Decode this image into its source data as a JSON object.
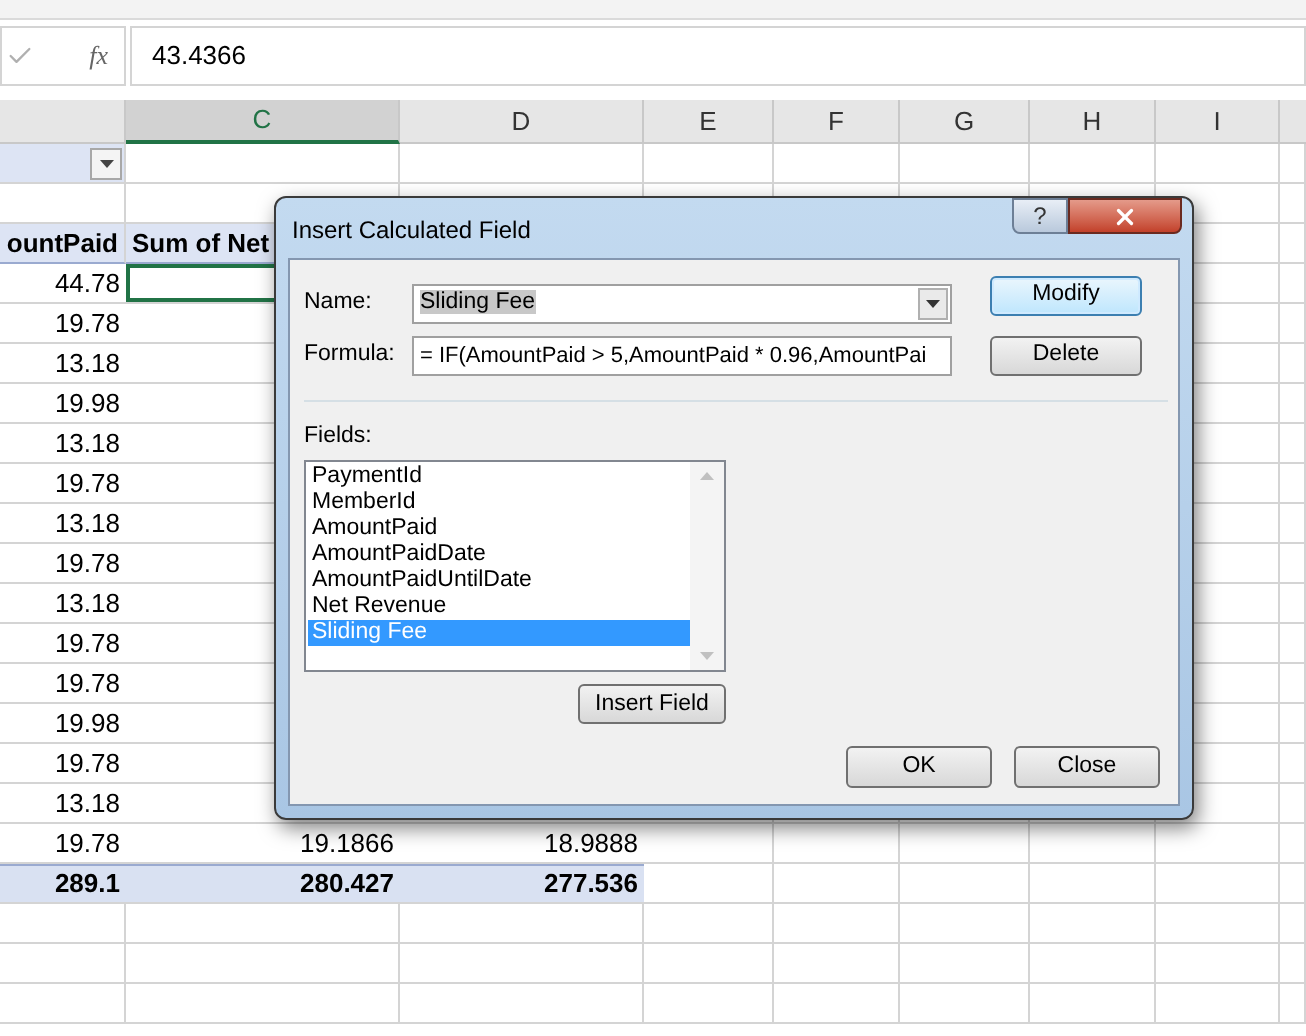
{
  "formula_bar": {
    "function_glyph": "fx",
    "value": "43.4366"
  },
  "columns": [
    {
      "selected": false
    },
    {
      "label": "C",
      "selected": true
    },
    {
      "label": "D",
      "selected": false
    },
    {
      "label": "E",
      "selected": false
    },
    {
      "label": "F",
      "selected": false
    },
    {
      "label": "G",
      "selected": false
    },
    {
      "label": "H",
      "selected": false
    },
    {
      "label": "I",
      "selected": false
    }
  ],
  "pivot": {
    "filter_dropdown": true,
    "header": [
      "ountPaid",
      "Sum of Net"
    ],
    "rows": [
      {
        "cells": [
          "44.78"
        ],
        "selected": true
      },
      {
        "cells": [
          "19.78"
        ],
        "selected": false
      },
      {
        "cells": [
          "13.18"
        ],
        "selected": false
      },
      {
        "cells": [
          "19.98"
        ],
        "selected": false
      },
      {
        "cells": [
          "13.18"
        ],
        "selected": false
      },
      {
        "cells": [
          "19.78"
        ],
        "selected": false
      },
      {
        "cells": [
          "13.18"
        ],
        "selected": false
      },
      {
        "cells": [
          "19.78"
        ],
        "selected": false
      },
      {
        "cells": [
          "13.18"
        ],
        "selected": false
      },
      {
        "cells": [
          "19.78"
        ],
        "selected": false
      },
      {
        "cells": [
          "19.78"
        ],
        "selected": false
      },
      {
        "cells": [
          "19.98"
        ],
        "selected": false
      },
      {
        "cells": [
          "19.78"
        ],
        "selected": false
      },
      {
        "cells": [
          "13.18"
        ],
        "selected": false
      },
      {
        "cells": [
          "19.78",
          "19.1866",
          "18.9888"
        ],
        "selected": false
      }
    ],
    "total": [
      "289.1",
      "280.427",
      "277.536"
    ]
  },
  "dialog": {
    "title": "Insert Calculated Field",
    "help": "?",
    "name_label": "Name:",
    "name_value": "Sliding Fee",
    "name_text_selected": true,
    "formula_label": "Formula:",
    "formula_value": "= IF(AmountPaid > 5,AmountPaid * 0.96,AmountPai",
    "modify_button": "Modify",
    "delete_button": "Delete",
    "fields_label": "Fields:",
    "fields": [
      {
        "label": "PaymentId",
        "selected": false
      },
      {
        "label": "MemberId",
        "selected": false
      },
      {
        "label": "AmountPaid",
        "selected": false
      },
      {
        "label": "AmountPaidDate",
        "selected": false
      },
      {
        "label": "AmountPaidUntilDate",
        "selected": false
      },
      {
        "label": "Net Revenue",
        "selected": false
      },
      {
        "label": "Sliding Fee",
        "selected": true
      }
    ],
    "insert_field_button": "Insert Field",
    "ok_button": "OK",
    "close_button": "Close"
  }
}
